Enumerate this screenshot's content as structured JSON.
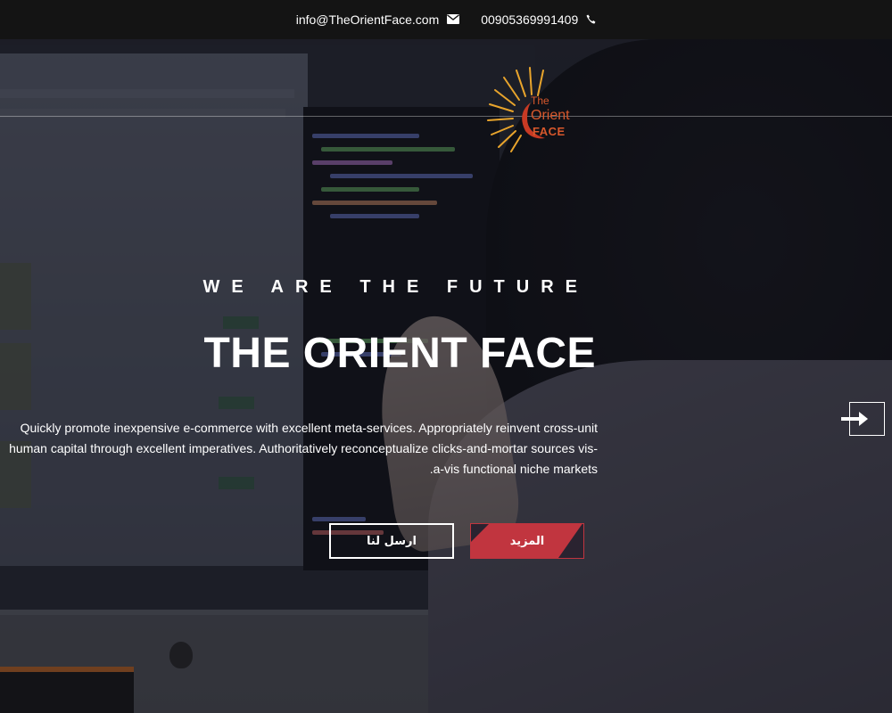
{
  "topbar": {
    "email": "info@TheOrientFace.com",
    "email_icon": "envelope-icon",
    "phone": "00905369991409",
    "phone_icon": "phone-icon"
  },
  "logo": {
    "line1": "The",
    "line2": "Orient",
    "line3": "FACE"
  },
  "hero": {
    "tagline": "WE ARE THE FUTURE",
    "title": "THE ORIENT FACE",
    "description": "Quickly promote inexpensive e-commerce with excellent meta-services. Appropriately reinvent cross-unit human capital through excellent imperatives. Authoritatively reconceptualize clicks-and-mortar sources vis-a-vis functional niche markets.",
    "contact_button": "ارسل لنا",
    "more_button": "المزيد",
    "next_icon": "arrow-right-icon"
  },
  "colors": {
    "accent": "#c1353f",
    "logo": "#d8582c",
    "topbar": "#141414"
  }
}
